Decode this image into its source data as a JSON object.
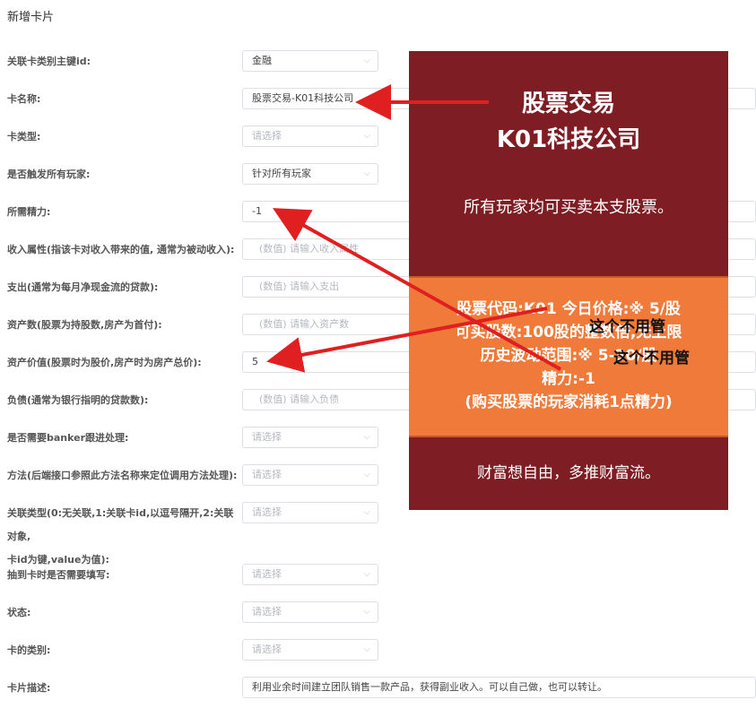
{
  "page": {
    "title": "新增卡片"
  },
  "form": {
    "card_category_id": {
      "label": "关联卡类别主键id:",
      "value": "金融"
    },
    "card_name": {
      "label": "卡名称:",
      "value": "股票交易-K01科技公司"
    },
    "card_type": {
      "label": "卡类型:",
      "placeholder": "请选择"
    },
    "trigger_all": {
      "label": "是否触发所有玩家:",
      "value": "针对所有玩家"
    },
    "energy": {
      "label": "所需精力:",
      "value": "-1"
    },
    "income": {
      "label": "收入属性(指该卡对收入带来的值, 通常为被动收入):",
      "placeholder": "(数值) 请输入收入属性"
    },
    "expense": {
      "label": "支出(通常为每月净现金流的贷款):",
      "placeholder": "(数值) 请输入支出"
    },
    "asset_count": {
      "label": "资产数(股票为持股数,房产为首付):",
      "placeholder": "(数值) 请输入资产数"
    },
    "asset_value": {
      "label": "资产价值(股票时为股价,房产时为房产总价):",
      "value": "5"
    },
    "liability": {
      "label": "负债(通常为银行指明的贷款数):",
      "placeholder": "(数值) 请输入负债"
    },
    "banker": {
      "label": "是否需要banker跟进处理:",
      "placeholder": "请选择"
    },
    "method": {
      "label": "方法(后端接口参照此方法名称来定位调用方法处理):",
      "placeholder": "请选择"
    },
    "relation_type": {
      "label": "关联类型(0:无关联,1:关联卡id,以逗号隔开,2:关联对象,卡id为键,value为值):",
      "label_line1": "关联类型(0:无关联,1:关联卡id,以逗号隔开,2:关联对象,",
      "label_line2": "卡id为键,value为值):",
      "placeholder": "请选择"
    },
    "fill_on_draw": {
      "label": "抽到卡时是否需要填写:",
      "placeholder": "请选择"
    },
    "status": {
      "label": "状态:",
      "placeholder": "请选择"
    },
    "card_class": {
      "label": "卡的类别:",
      "placeholder": "请选择"
    },
    "description": {
      "label": "卡片描述:",
      "value": "利用业余时间建立团队销售一款产品，获得副业收入。可以自己做，也可以转让。"
    }
  },
  "card_image": {
    "title_line1": "股票交易",
    "title_line2": "K01科技公司",
    "subtitle": "所有玩家均可买卖本支股票。",
    "band_lines": [
      "股票代码:K01  今日价格:※ 5/股",
      "可买股数:100股的整数倍,无上限",
      "历史波动范围:※ 5-30/股",
      "精力:-1",
      "(购买股票的玩家消耗1点精力)"
    ],
    "footer": "财富想自由，多推财富流。",
    "colors": {
      "background": "#7e1d24",
      "band": "#f07a3a"
    }
  },
  "annotations": {
    "note1": "这个不用管",
    "note2": "这个不用管",
    "arrow_color": "#e02020"
  }
}
